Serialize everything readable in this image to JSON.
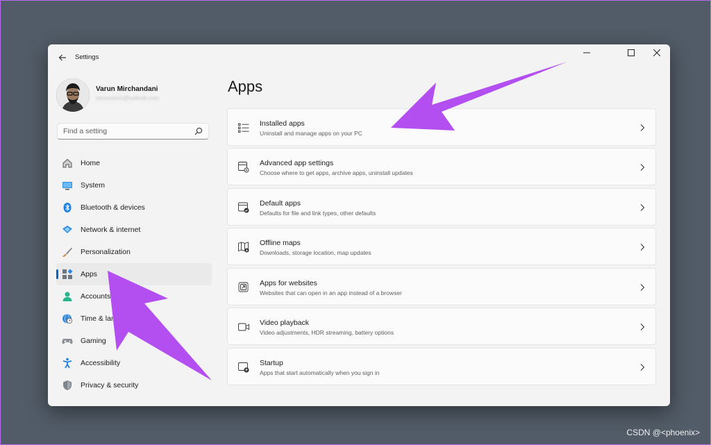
{
  "window": {
    "title": "Settings",
    "controls": {
      "minimize": "minimize-icon",
      "maximize": "maximize-icon",
      "close": "close-icon"
    }
  },
  "user": {
    "name": "Varun Mirchandani",
    "email": "varunmirch@outlook.com"
  },
  "search": {
    "placeholder": "Find a setting"
  },
  "sidebar": {
    "items": [
      {
        "label": "Home",
        "icon": "home-icon"
      },
      {
        "label": "System",
        "icon": "system-icon"
      },
      {
        "label": "Bluetooth & devices",
        "icon": "bluetooth-icon"
      },
      {
        "label": "Network & internet",
        "icon": "network-icon"
      },
      {
        "label": "Personalization",
        "icon": "brush-icon"
      },
      {
        "label": "Apps",
        "icon": "apps-icon",
        "selected": true
      },
      {
        "label": "Accounts",
        "icon": "account-icon"
      },
      {
        "label": "Time & language",
        "icon": "globe-clock-icon"
      },
      {
        "label": "Gaming",
        "icon": "gamepad-icon"
      },
      {
        "label": "Accessibility",
        "icon": "accessibility-icon"
      },
      {
        "label": "Privacy & security",
        "icon": "shield-icon"
      }
    ]
  },
  "main": {
    "title": "Apps",
    "cards": [
      {
        "title": "Installed apps",
        "subtitle": "Uninstall and manage apps on your PC",
        "icon": "list-icon"
      },
      {
        "title": "Advanced app settings",
        "subtitle": "Choose where to get apps, archive apps, uninstall updates",
        "icon": "app-settings-icon"
      },
      {
        "title": "Default apps",
        "subtitle": "Defaults for file and link types, other defaults",
        "icon": "default-apps-icon"
      },
      {
        "title": "Offline maps",
        "subtitle": "Downloads, storage location, map updates",
        "icon": "map-icon"
      },
      {
        "title": "Apps for websites",
        "subtitle": "Websites that can open in an app instead of a browser",
        "icon": "open-link-icon"
      },
      {
        "title": "Video playback",
        "subtitle": "Video adjustments, HDR streaming, battery options",
        "icon": "video-icon"
      },
      {
        "title": "Startup",
        "subtitle": "Apps that start automatically when you sign in",
        "icon": "startup-icon"
      }
    ]
  },
  "annotations": {
    "arrow_color": "#b34ef0"
  },
  "watermark": "CSDN @<phoenix>",
  "colors": {
    "accent": "#0067c0",
    "background": "#525c68",
    "window": "#f3f3f3"
  }
}
